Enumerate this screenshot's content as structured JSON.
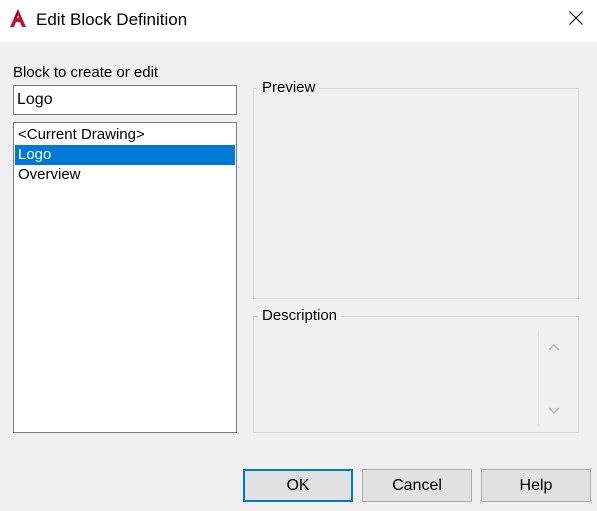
{
  "window": {
    "title": "Edit Block Definition",
    "icon": "autocad-a-icon",
    "close_icon": "close-icon"
  },
  "block_panel": {
    "label": "Block to create or edit",
    "name_value": "Logo",
    "list_items": [
      "<Current Drawing>",
      "Logo",
      "Overview"
    ],
    "selected_item": "Logo"
  },
  "preview": {
    "label": "Preview"
  },
  "description": {
    "label": "Description",
    "text": ""
  },
  "buttons": {
    "ok": "OK",
    "cancel": "Cancel",
    "help": "Help"
  },
  "colors": {
    "selection": "#0078d7",
    "app_icon": "#c8102e"
  }
}
